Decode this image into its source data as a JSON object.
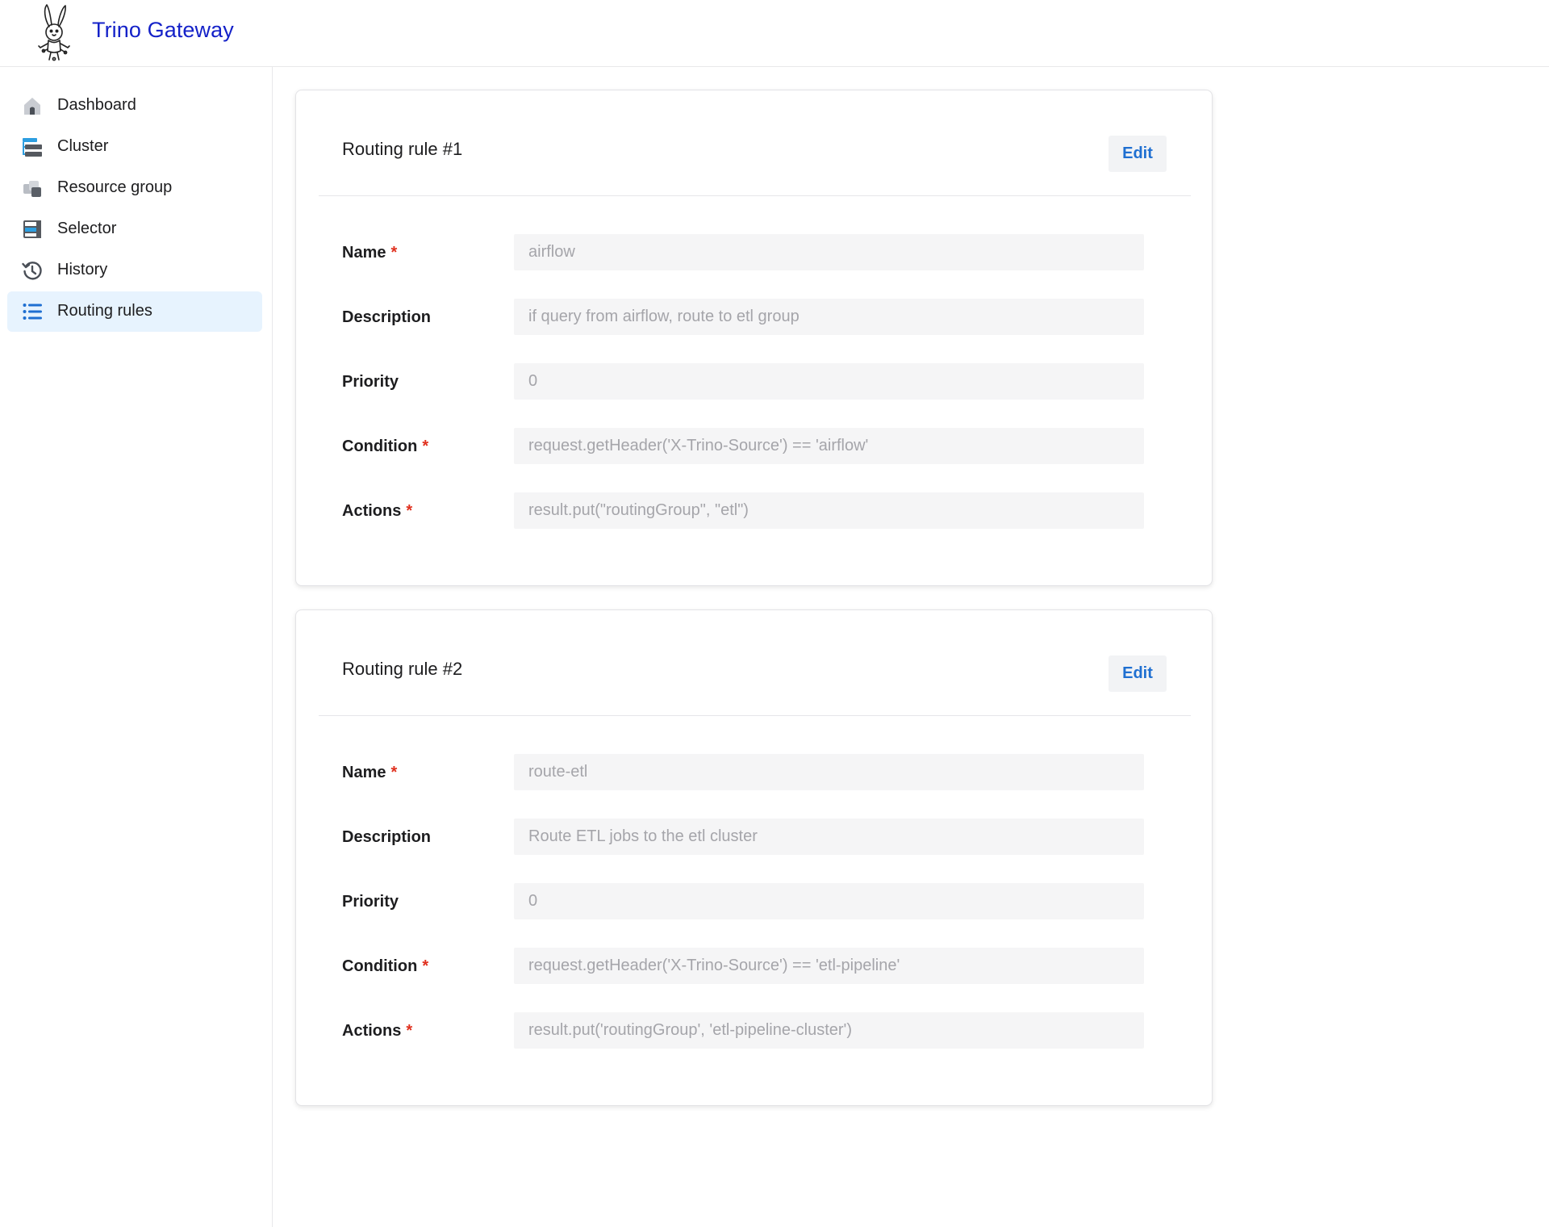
{
  "app": {
    "title": "Trino Gateway"
  },
  "sidebar": {
    "items": [
      {
        "label": "Dashboard",
        "icon": "home-icon",
        "active": false
      },
      {
        "label": "Cluster",
        "icon": "cluster-icon",
        "active": false
      },
      {
        "label": "Resource group",
        "icon": "resource-group-icon",
        "active": false
      },
      {
        "label": "Selector",
        "icon": "selector-icon",
        "active": false
      },
      {
        "label": "History",
        "icon": "history-icon",
        "active": false
      },
      {
        "label": "Routing rules",
        "icon": "list-icon",
        "active": true
      }
    ]
  },
  "rules": [
    {
      "title": "Routing rule #1",
      "edit_label": "Edit",
      "fields": {
        "name": {
          "label": "Name",
          "required": true,
          "value": "airflow"
        },
        "description": {
          "label": "Description",
          "required": false,
          "value": "if query from airflow, route to etl group"
        },
        "priority": {
          "label": "Priority",
          "required": false,
          "value": "0"
        },
        "condition": {
          "label": "Condition",
          "required": true,
          "value": "request.getHeader('X-Trino-Source') == 'airflow'"
        },
        "actions": {
          "label": "Actions",
          "required": true,
          "value": "result.put(\"routingGroup\", \"etl\")"
        }
      }
    },
    {
      "title": "Routing rule #2",
      "edit_label": "Edit",
      "fields": {
        "name": {
          "label": "Name",
          "required": true,
          "value": "route-etl"
        },
        "description": {
          "label": "Description",
          "required": false,
          "value": "Route ETL jobs to the etl cluster"
        },
        "priority": {
          "label": "Priority",
          "required": false,
          "value": "0"
        },
        "condition": {
          "label": "Condition",
          "required": true,
          "value": "request.getHeader('X-Trino-Source') == 'etl-pipeline'"
        },
        "actions": {
          "label": "Actions",
          "required": true,
          "value": "result.put('routingGroup', 'etl-pipeline-cluster')"
        }
      }
    }
  ],
  "required_marker": "*",
  "colors": {
    "brand": "#1421c8",
    "active_nav_bg": "#e7f3fe",
    "edit_text": "#1f6fd1",
    "required": "#e0301e",
    "field_bg": "#f5f5f6",
    "field_text": "#a5a5aa"
  }
}
